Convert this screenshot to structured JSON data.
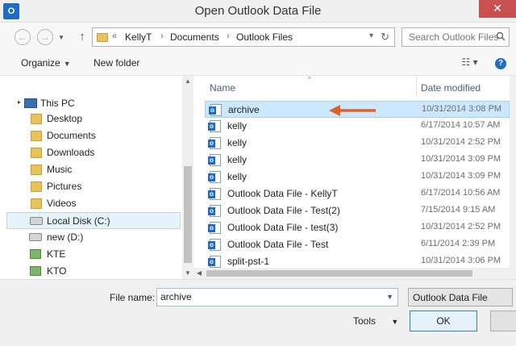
{
  "window": {
    "title": "Open Outlook Data File",
    "app_icon": "O",
    "close_glyph": "✕"
  },
  "nav": {
    "back_glyph": "←",
    "forward_glyph": "→",
    "up_glyph": "↑"
  },
  "address": {
    "overflow": "«",
    "segments": [
      "KellyT",
      "Documents",
      "Outlook Files"
    ],
    "separator": "›",
    "dropdown_glyph": "▾",
    "refresh_glyph": "↻"
  },
  "search": {
    "placeholder": "Search Outlook Files"
  },
  "toolbar": {
    "organize": "Organize",
    "caret": "▼",
    "new_folder": "New folder",
    "view_glyph": "☷ ▾",
    "help_glyph": "?"
  },
  "sidebar": {
    "items": [
      {
        "label": "This PC",
        "icon": "pc-icon"
      },
      {
        "label": "Desktop",
        "icon": "folder-icon"
      },
      {
        "label": "Documents",
        "icon": "folder-icon"
      },
      {
        "label": "Downloads",
        "icon": "folder-icon"
      },
      {
        "label": "Music",
        "icon": "folder-icon"
      },
      {
        "label": "Pictures",
        "icon": "folder-icon"
      },
      {
        "label": "Videos",
        "icon": "folder-icon"
      },
      {
        "label": "Local Disk (C:)",
        "icon": "disk-icon"
      },
      {
        "label": "new (D:)",
        "icon": "disk-icon"
      },
      {
        "label": "KTE",
        "icon": "network-drive-icon"
      },
      {
        "label": "KTO",
        "icon": "network-drive-icon"
      }
    ],
    "expander_glyph": "▸"
  },
  "list": {
    "columns": {
      "name": "Name",
      "date": "Date modified",
      "sort_glyph": "^"
    },
    "files": [
      {
        "name": "archive",
        "date": "10/31/2014 3:08 PM"
      },
      {
        "name": "kelly",
        "date": "6/17/2014 10:57 AM"
      },
      {
        "name": "kelly",
        "date": "10/31/2014 2:52 PM"
      },
      {
        "name": "kelly",
        "date": "10/31/2014 3:09 PM"
      },
      {
        "name": "kelly",
        "date": "10/31/2014 3:09 PM"
      },
      {
        "name": "Outlook Data File - KellyT",
        "date": "6/17/2014 10:56 AM"
      },
      {
        "name": "Outlook Data File - Test(2)",
        "date": "7/15/2014 9:15 AM"
      },
      {
        "name": "Outlook Data File - test(3)",
        "date": "10/31/2014 2:52 PM"
      },
      {
        "name": "Outlook Data File - Test",
        "date": "6/11/2014 2:39 PM"
      },
      {
        "name": "split-pst-1",
        "date": "10/31/2014 3:06 PM"
      }
    ],
    "selected_index": 0
  },
  "scroll": {
    "up_glyph": "▲",
    "down_glyph": "▼",
    "left_glyph": "◀"
  },
  "bottom": {
    "file_name_label": "File name:",
    "file_name_value": "archive",
    "file_name_drop": "▼",
    "file_type": "Outlook Data File",
    "tools_label": "Tools",
    "tools_caret": "▼",
    "ok_label": "OK"
  },
  "colors": {
    "selection": "#cce8ff",
    "annotation_arrow": "#e0602a",
    "title_close": "#c75050"
  }
}
